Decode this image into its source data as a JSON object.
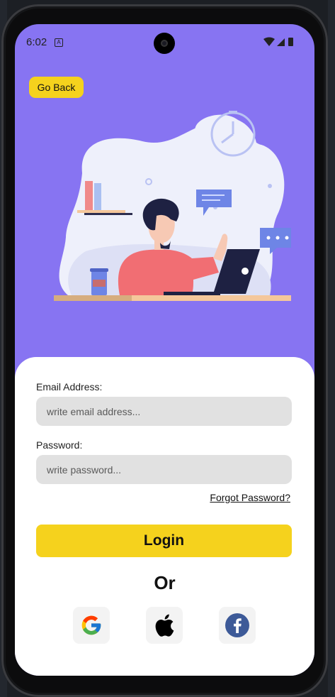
{
  "status_bar": {
    "time": "6:02"
  },
  "header": {
    "back_label": "Go Back"
  },
  "form": {
    "email_label": "Email Address:",
    "email_placeholder": "write email address...",
    "email_value": "",
    "password_label": "Password:",
    "password_placeholder": "write password...",
    "password_value": "",
    "forgot_label": "Forgot Password?",
    "login_label": "Login",
    "or_label": "Or"
  },
  "social": {
    "providers": [
      "google-icon",
      "apple-icon",
      "facebook-icon"
    ]
  },
  "colors": {
    "header_bg": "#8774f2",
    "accent": "#f5d21d",
    "field_bg": "#e1e1e1",
    "card_bg": "#ffffff"
  }
}
